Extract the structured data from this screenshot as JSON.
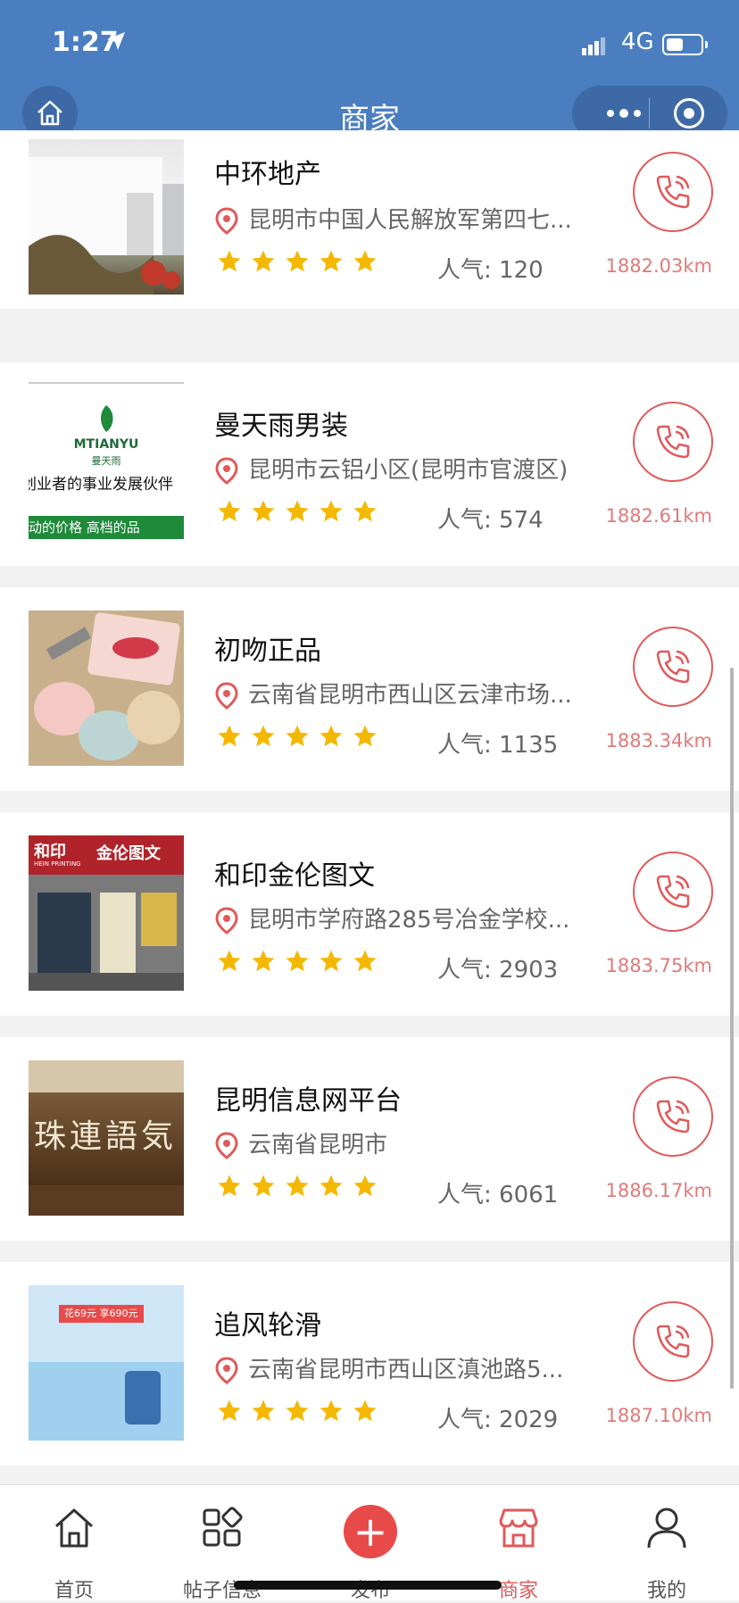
{
  "status_bar": {
    "time": "1:27",
    "network": "4G"
  },
  "nav": {
    "title": "商家"
  },
  "merchants": [
    {
      "name": "中环地产",
      "address": "昆明市中国人民解放军第四七...",
      "rating": 5,
      "popularity_label": "人气:",
      "popularity": "120",
      "distance": "1882.03km"
    },
    {
      "name": "曼天雨男装",
      "address": "昆明市云铝小区(昆明市官渡区)",
      "rating": 5,
      "popularity_label": "人气:",
      "popularity": "574",
      "distance": "1882.61km",
      "thumb_text": {
        "brand": "MTIANYU",
        "sub": "曼天雨",
        "line1": "创业者的事业发展伙伴",
        "line2": "动的价格 高档的品"
      }
    },
    {
      "name": "初吻正品",
      "address": "云南省昆明市西山区云津市场...",
      "rating": 5,
      "popularity_label": "人气:",
      "popularity": "1135",
      "distance": "1883.34km"
    },
    {
      "name": "和印金伦图文",
      "address": "昆明市学府路285号冶金学校...",
      "rating": 5,
      "popularity_label": "人气:",
      "popularity": "2903",
      "distance": "1883.75km",
      "thumb_text": {
        "sign_left": "和印",
        "sign_right": "金伦图文",
        "sign_en": "HEIN PRINTING"
      }
    },
    {
      "name": "昆明信息网平台",
      "address": "云南省昆明市",
      "rating": 5,
      "popularity_label": "人气:",
      "popularity": "6061",
      "distance": "1886.17km",
      "thumb_text": {
        "carving": "珠連語気"
      }
    },
    {
      "name": "追风轮滑",
      "address": "云南省昆明市西山区滇池路5...",
      "rating": 5,
      "popularity_label": "人气:",
      "popularity": "2029",
      "distance": "1887.10km",
      "thumb_text": {
        "promo": "花69元 享690元"
      }
    }
  ],
  "tabbar": {
    "home": "首页",
    "posts": "帖子信息",
    "publish": "发布",
    "merchants": "商家",
    "mine": "我的"
  },
  "colors": {
    "header": "#4a7ec0",
    "accent": "#e05a5a",
    "star": "#f5b800"
  }
}
